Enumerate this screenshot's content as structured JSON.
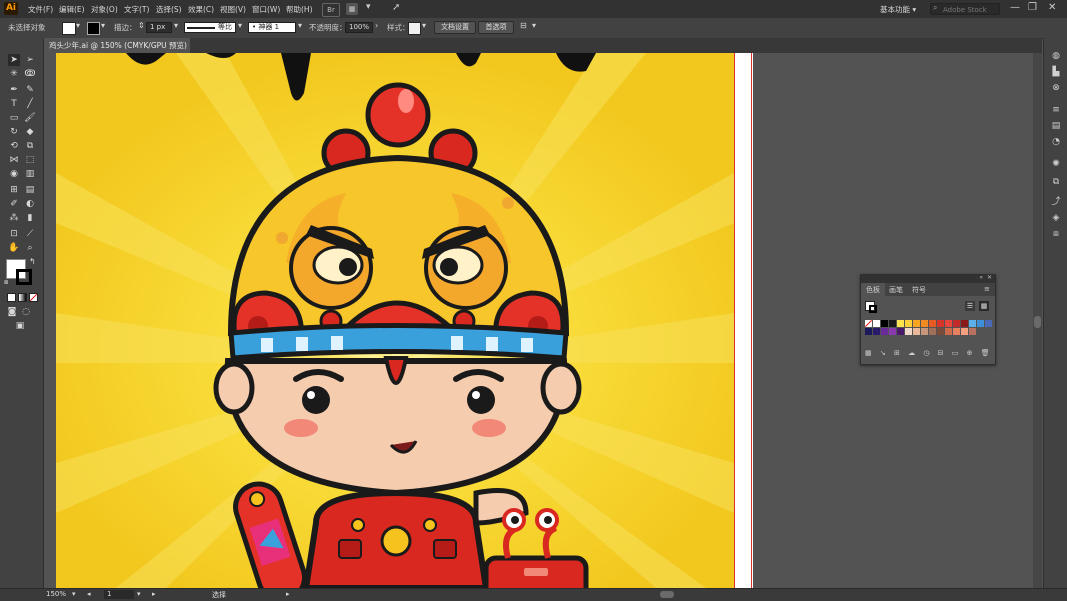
{
  "app": {
    "logo": "Ai"
  },
  "menu": [
    "文件(F)",
    "编辑(E)",
    "对象(O)",
    "文字(T)",
    "选择(S)",
    "效果(C)",
    "视图(V)",
    "窗口(W)",
    "帮助(H)"
  ],
  "workspace": {
    "label": "基本功能",
    "dropdown": "▾"
  },
  "search": {
    "placeholder": "Adobe Stock"
  },
  "window_controls": {
    "minimize": "—",
    "restore": "❐",
    "close": "✕"
  },
  "control_bar": {
    "selection_label": "未选择对象",
    "stroke_label": "描边：",
    "stroke_value": "1 px",
    "profile_label": "等比",
    "brush_label": "• 神器 1",
    "opacity_label": "不透明度：",
    "opacity_value": "100%",
    "style_label": "样式：",
    "doc_setup_button": "文档设置",
    "prefs_button": "首选项"
  },
  "document_tab": {
    "title": "鸡头少年.ai @ 150% (CMYK/GPU 预览)",
    "close": "✕"
  },
  "swatches_panel": {
    "tabs": [
      "色板",
      "画笔",
      "符号"
    ],
    "menu_icon": "≡",
    "swatch_colors_row1": [
      "#ffffff",
      "#ffffff",
      "#000000",
      "#1a1a1a",
      "#ffe34f",
      "#ffd23a",
      "#f6a623",
      "#f08a22",
      "#e85a24",
      "#d8342a",
      "#e8463b",
      "#c42a2a",
      "#8a1a1a",
      "#5bb0e8",
      "#3d8fd8",
      "#4a6ab8"
    ],
    "swatch_colors_row2": [
      "#1a1a5a",
      "#2a1a6a",
      "#6a2a9a",
      "#8a3ab0",
      "#4a1a6a",
      "#f0d8c8",
      "#e8b898",
      "#c8967a",
      "#a0705a",
      "#7a4a3a",
      "#cc6a4a",
      "#e88060",
      "#f4a080",
      "#b87060"
    ]
  },
  "status_bar": {
    "zoom": "150%",
    "artboard": "1",
    "tool": "选择"
  },
  "colors": {
    "accent": "#ff9a00",
    "artboard_bg": "#f2c81e",
    "panel_bg": "#535353",
    "chrome_dark": "#323232"
  }
}
